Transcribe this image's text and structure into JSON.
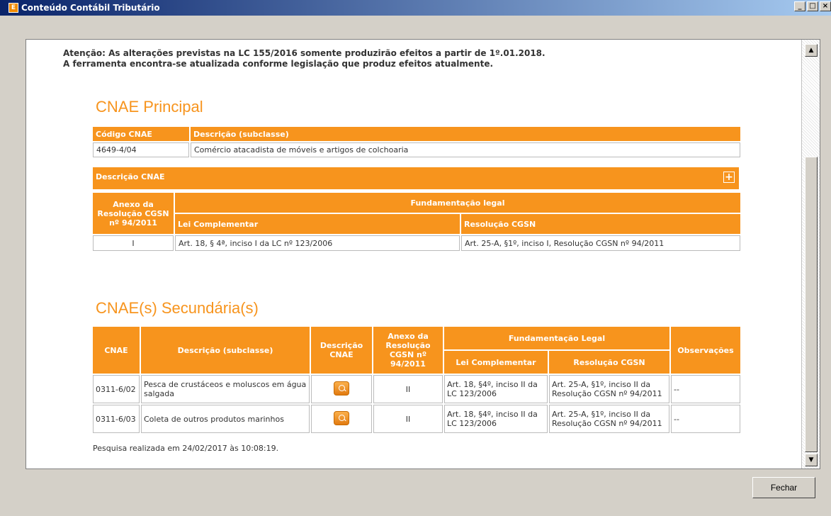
{
  "window": {
    "title": "Conteúdo Contábil Tributário"
  },
  "notice": {
    "line1": "Atenção: As alterações previstas na LC 155/2016 somente produzirão efeitos a partir de 1º.01.2018.",
    "line2": "A ferramenta encontra-se atualizada conforme legislação que produz efeitos atualmente."
  },
  "principal": {
    "title": "CNAE Principal",
    "col_code": "Código CNAE",
    "col_desc": "Descrição (subclasse)",
    "code": "4649-4/04",
    "description": "Comércio atacadista de móveis e artigos de colchoaria",
    "desc_bar": "Descrição CNAE",
    "annex_header": "Anexo da Resolução CGSN nº 94/2011",
    "legal_header": "Fundamentação legal",
    "lc_header": "Lei Complementar",
    "res_header": "Resolução CGSN",
    "annex": "I",
    "lc": "Art. 18, § 4ª, inciso I da LC nº 123/2006",
    "res": "Art. 25-A, §1º, inciso I, Resolução CGSN nº 94/2011"
  },
  "secondary": {
    "title": "CNAE(s) Secundária(s)",
    "headers": {
      "cnae": "CNAE",
      "desc": "Descrição (subclasse)",
      "desc_cnae": "Descrição CNAE",
      "annex": "Anexo da Resolução CGSN nº 94/2011",
      "legal": "Fundamentação Legal",
      "lc": "Lei Complementar",
      "res": "Resolução CGSN",
      "obs": "Observações"
    },
    "rows": [
      {
        "cnae": "0311-6/02",
        "desc": "Pesca de crustáceos e moluscos em água salgada",
        "annex": "II",
        "lc": "Art. 18, §4º, inciso II da LC 123/2006",
        "res": "Art. 25-A, §1º, inciso II da Resolução CGSN nº 94/2011",
        "obs": "--"
      },
      {
        "cnae": "0311-6/03",
        "desc": "Coleta de outros produtos marinhos",
        "annex": "II",
        "lc": "Art. 18, §4º, inciso II da LC 123/2006",
        "res": "Art. 25-A, §1º, inciso II da Resolução CGSN nº 94/2011",
        "obs": "--"
      }
    ]
  },
  "footer": "Pesquisa realizada em 24/02/2017 às 10:08:19.",
  "buttons": {
    "close": "Fechar"
  }
}
